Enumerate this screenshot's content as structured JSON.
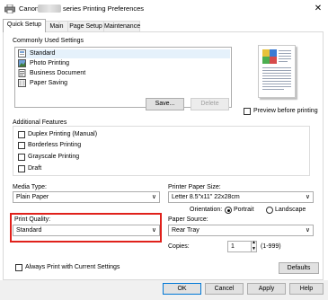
{
  "window": {
    "title_prefix": "Canon",
    "title_suffix": "series Printing Preferences"
  },
  "tabs": [
    "Quick Setup",
    "Main",
    "Page Setup",
    "Maintenance"
  ],
  "commonly_used": {
    "label": "Commonly Used Settings",
    "items": [
      {
        "label": "Standard",
        "icon": "standard-settings-icon"
      },
      {
        "label": "Photo Printing",
        "icon": "photo-printing-icon"
      },
      {
        "label": "Business Document",
        "icon": "business-document-icon"
      },
      {
        "label": "Paper Saving",
        "icon": "paper-saving-icon"
      }
    ],
    "save_label": "Save...",
    "delete_label": "Delete"
  },
  "preview": {
    "checkbox_label": "Preview before printing",
    "checked": false
  },
  "additional_features": {
    "label": "Additional Features",
    "items": [
      {
        "label": "Duplex Printing (Manual)",
        "checked": false
      },
      {
        "label": "Borderless Printing",
        "checked": false
      },
      {
        "label": "Grayscale Printing",
        "checked": false
      },
      {
        "label": "Draft",
        "checked": false
      }
    ]
  },
  "media_type": {
    "label": "Media Type:",
    "value": "Plain Paper"
  },
  "printer_paper_size": {
    "label": "Printer Paper Size:",
    "value": "Letter 8.5\"x11\" 22x28cm"
  },
  "orientation": {
    "label": "Orientation:",
    "portrait": "Portrait",
    "landscape": "Landscape",
    "selected": "Portrait"
  },
  "print_quality": {
    "label": "Print Quality:",
    "value": "Standard"
  },
  "paper_source": {
    "label": "Paper Source:",
    "value": "Rear Tray"
  },
  "copies": {
    "label": "Copies:",
    "value": "1",
    "range": "(1-999)"
  },
  "always_print": {
    "label": "Always Print with Current Settings",
    "checked": false
  },
  "defaults_label": "Defaults",
  "footer": {
    "ok": "OK",
    "cancel": "Cancel",
    "apply": "Apply",
    "help": "Help"
  },
  "colors": {
    "highlight": "#e0211b"
  }
}
